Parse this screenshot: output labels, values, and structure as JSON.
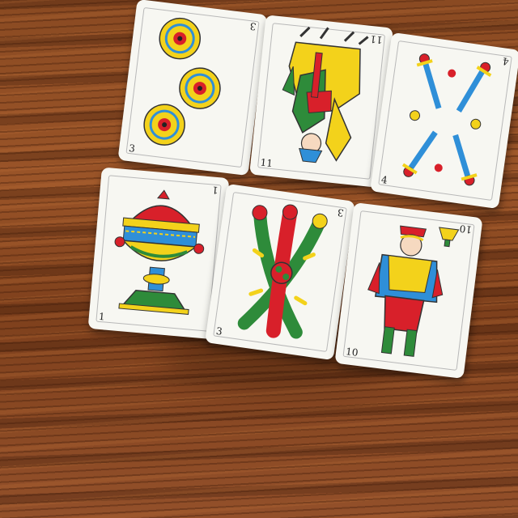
{
  "cards": [
    {
      "id": "coins-3",
      "rank": "3",
      "suit": "coins"
    },
    {
      "id": "horse-11",
      "rank": "11",
      "suit": "clubs"
    },
    {
      "id": "swords-4",
      "rank": "4",
      "suit": "swords"
    },
    {
      "id": "cups-1",
      "rank": "1",
      "suit": "cups"
    },
    {
      "id": "clubs-3",
      "rank": "3",
      "suit": "clubs"
    },
    {
      "id": "jack-10",
      "rank": "10",
      "suit": "cups"
    }
  ],
  "palette": {
    "red": "#d8202a",
    "yellow": "#f3d21b",
    "green": "#2e8b3a",
    "blue": "#2f8fd8",
    "wood": "#8a4a22",
    "card": "#f7f7f2"
  },
  "icons": [
    "gold-coin-icon",
    "sword-icon",
    "cup-icon",
    "club-icon",
    "knight-figure",
    "jack-figure"
  ]
}
